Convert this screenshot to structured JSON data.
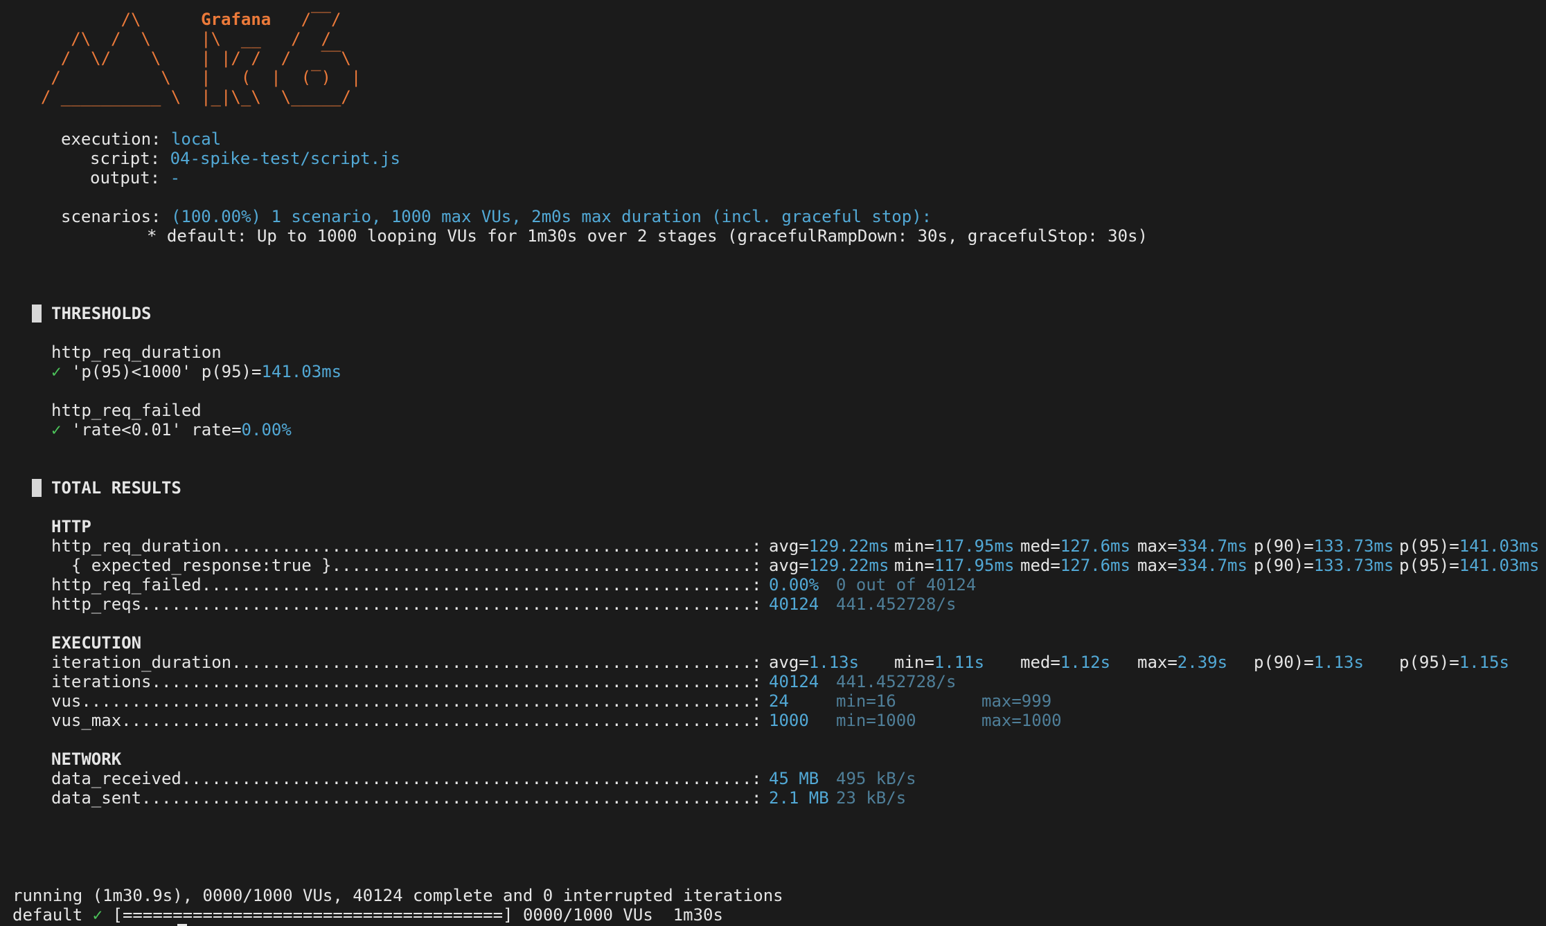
{
  "logo": {
    "brand": "Grafana",
    "ascii": "          /\\      Grafana   /‾‾/\n     /\\  /  \\     |\\  __   /  /\n    /  \\/    \\    | |/ /  /   ‾‾\\\n   /          \\   |   (  |  (‾)  |\n  / __________ \\  |_|\\_\\  \\_____/"
  },
  "header": {
    "execution_label": "execution:",
    "execution_value": "local",
    "script_label": "script:",
    "script_value": "04-spike-test/script.js",
    "output_label": "output:",
    "output_value": "-",
    "scenarios_label": "scenarios:",
    "scenarios_value": "(100.00%) 1 scenario, 1000 max VUs, 2m0s max duration (incl. graceful stop):",
    "scenario_detail": "* default: Up to 1000 looping VUs for 1m30s over 2 stages (gracefulRampDown: 30s, gracefulStop: 30s)"
  },
  "thresholds": {
    "title": "THRESHOLDS",
    "items": [
      {
        "metric": "http_req_duration",
        "check": "✓",
        "rule": "'p(95)<1000' p(95)=",
        "value": "141.03ms"
      },
      {
        "metric": "http_req_failed",
        "check": "✓",
        "rule": "'rate<0.01' rate=",
        "value": "0.00%"
      }
    ]
  },
  "results": {
    "title": "TOTAL RESULTS",
    "http": {
      "title": "HTTP",
      "rows": [
        {
          "name": "http_req_duration",
          "stats": [
            {
              "k": "avg=",
              "v": "129.22ms"
            },
            {
              "k": "min=",
              "v": "117.95ms"
            },
            {
              "k": "med=",
              "v": "127.6ms"
            },
            {
              "k": "max=",
              "v": "334.7ms"
            },
            {
              "k": "p(90)=",
              "v": "133.73ms"
            },
            {
              "k": "p(95)=",
              "v": "141.03ms"
            }
          ]
        },
        {
          "name": "  { expected_response:true }",
          "stats": [
            {
              "k": "avg=",
              "v": "129.22ms"
            },
            {
              "k": "min=",
              "v": "117.95ms"
            },
            {
              "k": "med=",
              "v": "127.6ms"
            },
            {
              "k": "max=",
              "v": "334.7ms"
            },
            {
              "k": "p(90)=",
              "v": "133.73ms"
            },
            {
              "k": "p(95)=",
              "v": "141.03ms"
            }
          ]
        },
        {
          "name": "http_req_failed",
          "value": "0.00%",
          "extra": [
            "0 out of 40124"
          ]
        },
        {
          "name": "http_reqs",
          "value": "40124",
          "extra": [
            "441.452728/s"
          ]
        }
      ]
    },
    "execution": {
      "title": "EXECUTION",
      "rows": [
        {
          "name": "iteration_duration",
          "stats": [
            {
              "k": "avg=",
              "v": "1.13s"
            },
            {
              "k": "min=",
              "v": "1.11s"
            },
            {
              "k": "med=",
              "v": "1.12s"
            },
            {
              "k": "max=",
              "v": "2.39s"
            },
            {
              "k": "p(90)=",
              "v": "1.13s"
            },
            {
              "k": "p(95)=",
              "v": "1.15s"
            }
          ]
        },
        {
          "name": "iterations",
          "value": "40124",
          "extra": [
            "441.452728/s"
          ]
        },
        {
          "name": "vus",
          "value": "24",
          "extra": [
            "min=16",
            "max=999"
          ]
        },
        {
          "name": "vus_max",
          "value": "1000",
          "extra": [
            "min=1000",
            "max=1000"
          ]
        }
      ]
    },
    "network": {
      "title": "NETWORK",
      "rows": [
        {
          "name": "data_received",
          "value": "45 MB",
          "extra": [
            "495 kB/s"
          ]
        },
        {
          "name": "data_sent",
          "value": "2.1 MB",
          "extra": [
            "23 kB/s"
          ]
        }
      ]
    }
  },
  "footer": {
    "running_line": "running (1m30.9s), 0000/1000 VUs, 40124 complete and 0 interrupted iterations",
    "progress_prefix": "default",
    "progress_check": "✓",
    "progress_bar": "[======================================]",
    "progress_suffix": "0000/1000 VUs  1m30s",
    "progress": 1.0
  }
}
